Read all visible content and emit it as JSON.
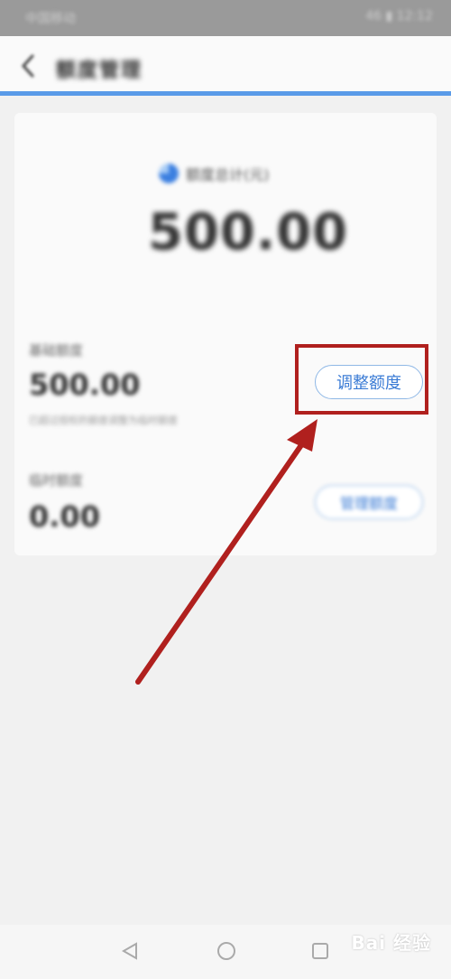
{
  "status_bar": {
    "carrier": "中国移动",
    "right": "46 ▮ 12:12"
  },
  "header": {
    "title": "额度管理"
  },
  "total": {
    "label": "额度总计(元)",
    "value": "500.00"
  },
  "basic": {
    "label": "基础额度",
    "value": "500.00",
    "note": "已超过授权的额度调整为临时额度",
    "button_label": "调整额度"
  },
  "temporary": {
    "label": "临时额度",
    "value": "0.00",
    "button_label": "管理额度"
  },
  "watermark": "Bai 经验",
  "colors": {
    "accent": "#3a7bd5",
    "highlight": "#b0201e",
    "header_line": "#5a9be8"
  },
  "icons": [
    "back-arrow-icon",
    "pie-chart-icon",
    "nav-back-icon",
    "nav-home-icon",
    "nav-recent-icon"
  ]
}
